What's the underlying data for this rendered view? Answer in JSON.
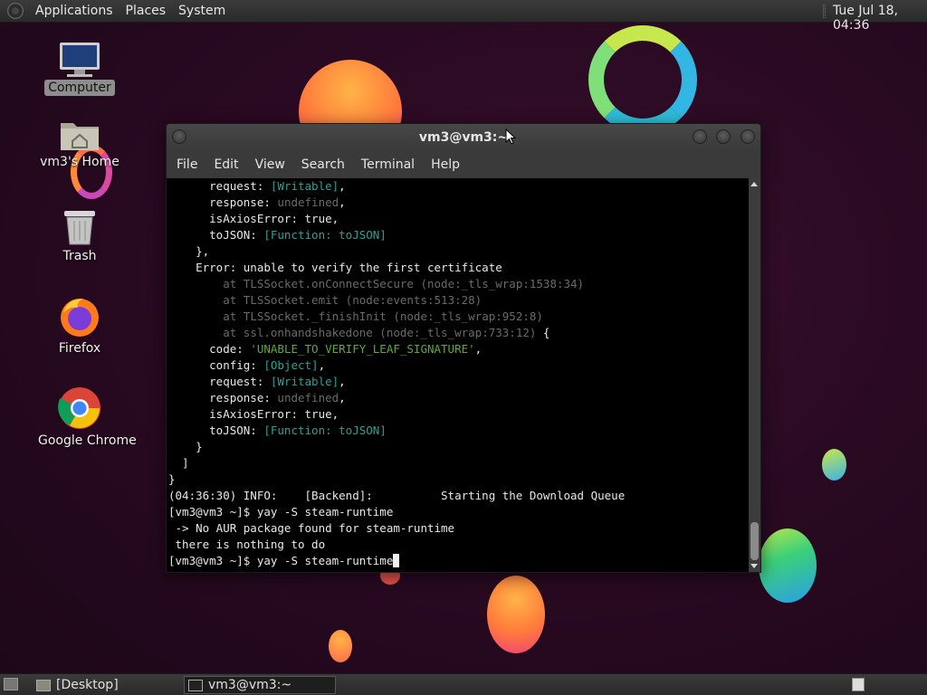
{
  "top_panel": {
    "menus": [
      "Applications",
      "Places",
      "System"
    ],
    "clock": "Tue Jul 18, 04:36"
  },
  "desktop": {
    "icons": [
      {
        "label": "Computer",
        "icon": "computer-icon"
      },
      {
        "label": "vm3's Home",
        "icon": "home-folder-icon"
      },
      {
        "label": "Trash",
        "icon": "trash-icon"
      },
      {
        "label": "Firefox",
        "icon": "firefox-icon"
      },
      {
        "label": "Google Chrome",
        "icon": "chrome-icon"
      }
    ]
  },
  "terminal": {
    "title": "vm3@vm3:~",
    "menu": [
      "File",
      "Edit",
      "View",
      "Search",
      "Terminal",
      "Help"
    ],
    "lines": [
      {
        "pre": "      request: ",
        "a": "[Writable]",
        "a_class": "c-cyan",
        "post": ","
      },
      {
        "pre": "      response: ",
        "a": "undefined",
        "a_class": "c-gray",
        "post": ","
      },
      {
        "pre": "      isAxiosError: ",
        "a": "true",
        "a_class": "",
        "post": ","
      },
      {
        "pre": "      toJSON: ",
        "a": "[Function: toJSON]",
        "a_class": "c-cyan",
        "post": ""
      },
      {
        "pre": "    },",
        "a": "",
        "a_class": "",
        "post": ""
      },
      {
        "pre": "    Error: unable to verify the first certificate",
        "a": "",
        "a_class": "",
        "post": ""
      },
      {
        "pre": "        ",
        "a": "at TLSSocket.onConnectSecure (node:_tls_wrap:1538:34)",
        "a_class": "c-gray",
        "post": ""
      },
      {
        "pre": "        ",
        "a": "at TLSSocket.emit (node:events:513:28)",
        "a_class": "c-gray",
        "post": ""
      },
      {
        "pre": "        ",
        "a": "at TLSSocket._finishInit (node:_tls_wrap:952:8)",
        "a_class": "c-gray",
        "post": ""
      },
      {
        "pre": "        ",
        "a": "at ssl.onhandshakedone (node:_tls_wrap:733:12)",
        "a_class": "c-gray",
        "post": " {"
      },
      {
        "pre": "      code: ",
        "a": "'UNABLE_TO_VERIFY_LEAF_SIGNATURE'",
        "a_class": "c-green",
        "post": ","
      },
      {
        "pre": "      config: ",
        "a": "[Object]",
        "a_class": "c-cyan",
        "post": ","
      },
      {
        "pre": "      request: ",
        "a": "[Writable]",
        "a_class": "c-cyan",
        "post": ","
      },
      {
        "pre": "      response: ",
        "a": "undefined",
        "a_class": "c-gray",
        "post": ","
      },
      {
        "pre": "      isAxiosError: ",
        "a": "true",
        "a_class": "",
        "post": ","
      },
      {
        "pre": "      toJSON: ",
        "a": "[Function: toJSON]",
        "a_class": "c-cyan",
        "post": ""
      },
      {
        "pre": "    }",
        "a": "",
        "a_class": "",
        "post": ""
      },
      {
        "pre": "  ]",
        "a": "",
        "a_class": "",
        "post": ""
      },
      {
        "pre": "}",
        "a": "",
        "a_class": "",
        "post": ""
      },
      {
        "pre": "(04:36:30) INFO:    [Backend]:          Starting the Download Queue",
        "a": "",
        "a_class": "",
        "post": ""
      },
      {
        "pre": "[vm3@vm3 ~]$ yay -S steam-runtime",
        "a": "",
        "a_class": "",
        "post": ""
      },
      {
        "pre": " -> No AUR package found for steam-runtime",
        "a": "",
        "a_class": "",
        "post": ""
      },
      {
        "pre": " there is nothing to do",
        "a": "",
        "a_class": "",
        "post": ""
      }
    ],
    "prompt_line": "[vm3@vm3 ~]$ yay -S steam-runtime"
  },
  "taskbar": {
    "tasks": [
      {
        "label": "[Desktop]",
        "active": false
      },
      {
        "label": "vm3@vm3:~",
        "active": true
      }
    ]
  },
  "colors": {
    "terminal_bg": "#000000",
    "cyan": "#2aa198",
    "green": "#5fa83a",
    "gray": "#6a6a6a"
  }
}
